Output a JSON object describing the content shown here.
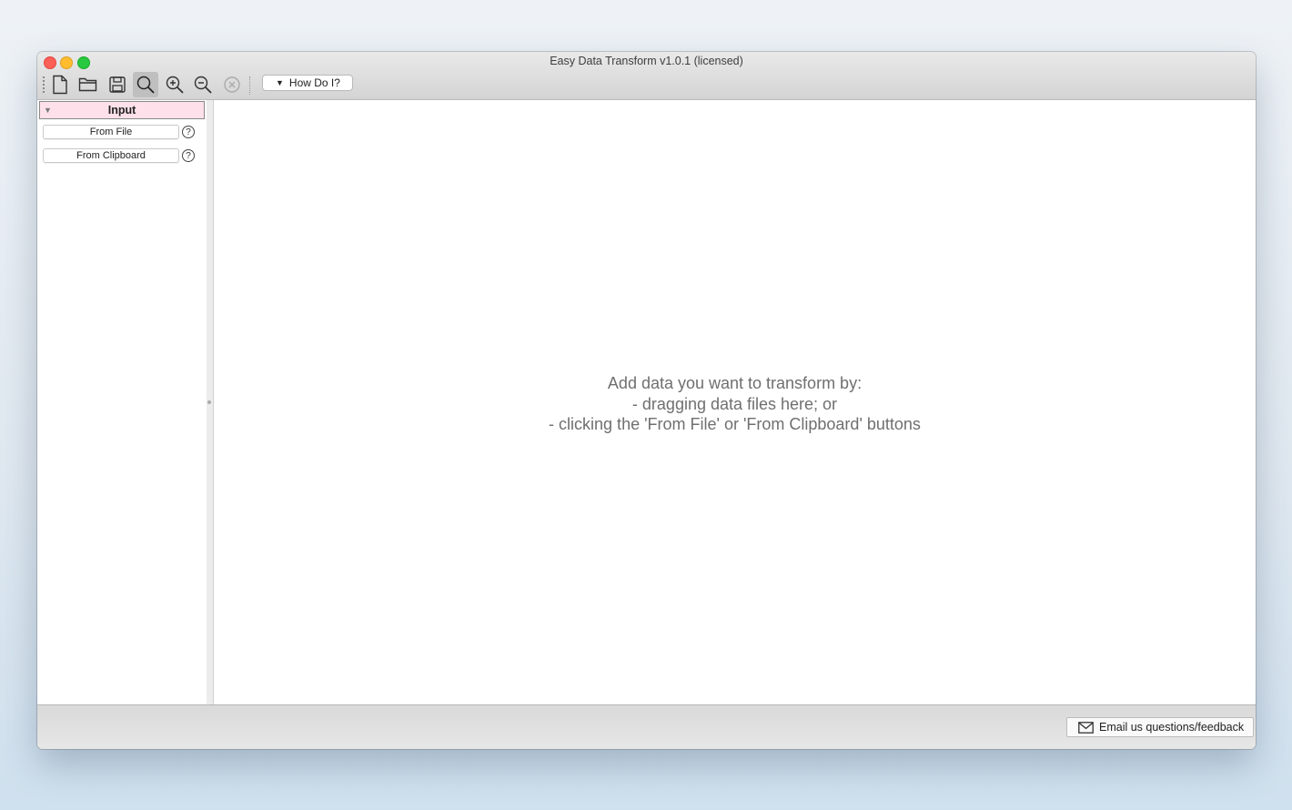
{
  "window": {
    "title": "Easy Data Transform v1.0.1 (licensed)"
  },
  "toolbar": {
    "buttons": [
      "new-file-icon",
      "open-folder-icon",
      "save-icon",
      "search-icon",
      "zoom-in-icon",
      "zoom-out-icon",
      "clear-icon"
    ],
    "how_do_i_label": "How Do I?",
    "how_do_i_arrow": "▼"
  },
  "sidebar": {
    "section_title": "Input",
    "section_toggle": "▼",
    "from_file_label": "From File",
    "from_clipboard_label": "From Clipboard",
    "help_glyph": "?"
  },
  "main": {
    "drop_line_1": "Add data you want to transform by:",
    "drop_line_2": "- dragging data files here; or",
    "drop_line_3": "- clicking the 'From File' or 'From Clipboard' buttons"
  },
  "status": {
    "email_label": "Email us questions/feedback"
  },
  "colors": {
    "input_header_bg": "#fde0ea",
    "close": "#fe5f57",
    "minimize": "#febc2e",
    "maximize": "#28c840"
  }
}
